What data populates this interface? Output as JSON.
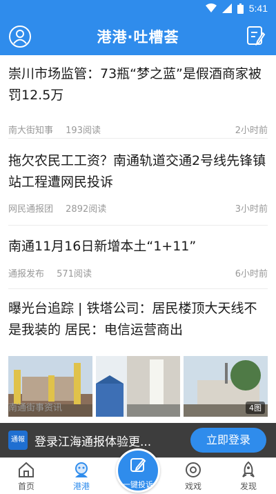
{
  "status_bar": {
    "time": "5:41"
  },
  "app_bar": {
    "title": "港港·吐槽荟"
  },
  "articles": [
    {
      "headline": "崇川市场监管：73瓶“梦之蓝”是假酒商家被罚12.5万",
      "source": "南大街知事",
      "reads": "193阅读",
      "time": "2小时前"
    },
    {
      "headline": "拖欠农民工工资？南通轨道交通2号线先锋镇站工程遭网民投诉",
      "source": "网民通报团",
      "reads": "2892阅读",
      "time": "3小时前"
    },
    {
      "headline": "南通11月16日新增本土“1+11”",
      "source": "通报发布",
      "reads": "571阅读",
      "time": "6小时前"
    },
    {
      "headline": "曝光台追踪 | 铁塔公司：居民楼顶大天线不是我装的 居民：电信运营商出",
      "source": "南通街事资讯",
      "reads": "",
      "time": "",
      "pic_count": "4图"
    }
  ],
  "login_banner": {
    "logo_text": "通報",
    "text": "登录江海通报体验更...",
    "button": "立即登录"
  },
  "bottom_nav": {
    "home": "首页",
    "ganggang": "港港",
    "complain": "一键投诉",
    "xixi": "戏戏",
    "discover": "发现"
  },
  "colors": {
    "brand": "#2f8cec",
    "meta": "#999999"
  }
}
